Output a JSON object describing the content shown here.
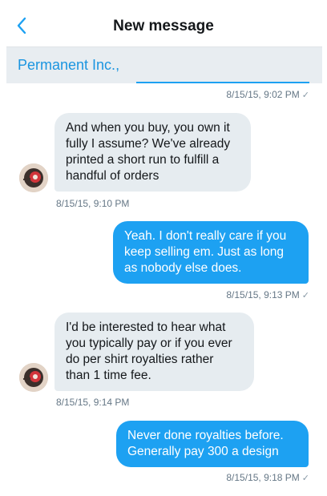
{
  "header": {
    "title": "New message",
    "back_icon": "chevron-left-icon"
  },
  "recipient": {
    "text": "Permanent Inc.,"
  },
  "messages": [
    {
      "direction": "out",
      "partial": true,
      "timestamp": "8/15/15, 9:02 PM",
      "read": true
    },
    {
      "direction": "in",
      "lines": [
        "And when you buy, you own it",
        "fully I assume? We've already",
        "printed a short run to fulfill a",
        "handful of orders"
      ],
      "timestamp": "8/15/15, 9:10 PM"
    },
    {
      "direction": "out",
      "lines": [
        "Yeah.  I don't really care if you",
        "keep selling em.  Just as long",
        "as nobody else does."
      ],
      "timestamp": "8/15/15, 9:13 PM",
      "read": true
    },
    {
      "direction": "in",
      "lines": [
        "I'd be interested to hear what",
        "you typically pay or if you ever",
        "do per shirt royalties rather",
        "than 1 time fee."
      ],
      "timestamp": "8/15/15, 9:14 PM"
    },
    {
      "direction": "out",
      "lines": [
        "Never done royalties before.",
        "Generally pay 300 a design"
      ],
      "timestamp": "8/15/15, 9:18 PM",
      "read": true
    }
  ],
  "read_receipt_glyph": "✓",
  "colors": {
    "accent": "#1da1f2",
    "incoming_bubble": "#e6ecf0",
    "timestamp": "#657786"
  }
}
